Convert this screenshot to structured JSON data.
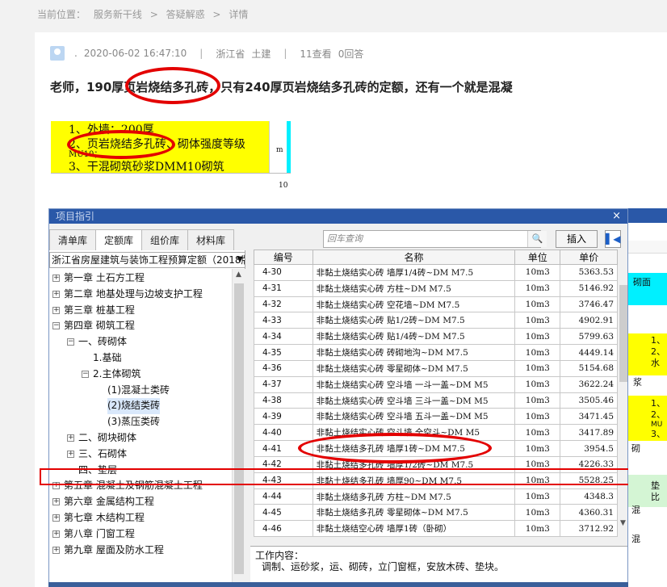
{
  "breadcrumb": [
    "当前位置：",
    "服务新干线",
    ">",
    "答疑解惑",
    ">",
    "详情"
  ],
  "meta": {
    "user": ".",
    "datetime": "2020-06-02 16:47:10",
    "region": "浙江省",
    "category": "土建",
    "views": "11查看",
    "answers": "0回答"
  },
  "question": "老师，190厚页岩烧结多孔砖，只有240厚页岩烧结多孔砖的定额，还有一个就是混凝",
  "excel": {
    "line1": "1、外墙：200厚",
    "line2": "2、页岩烧结多孔砖、砌体强度等级",
    "line2b": "MU10；",
    "line3": "3、干混砌筑砂浆DMM10砌筑",
    "unit_partial": "m",
    "below": "10"
  },
  "dialog": {
    "title": "项目指引",
    "close": "×",
    "tabs": [
      "清单库",
      "定额库",
      "组价库",
      "材料库"
    ],
    "active_tab": 1,
    "library": "浙江省房屋建筑与装饰工程预算定额（2018版）",
    "search_placeholder": "回车查询",
    "insert_label": "插入",
    "tree": [
      {
        "label": "第一章 土石方工程",
        "indent": 0,
        "box": "+"
      },
      {
        "label": "第二章 地基处理与边坡支护工程",
        "indent": 0,
        "box": "+"
      },
      {
        "label": "第三章 桩基工程",
        "indent": 0,
        "box": "+"
      },
      {
        "label": "第四章 砌筑工程",
        "indent": 0,
        "box": "-"
      },
      {
        "label": "一、砖砌体",
        "indent": 1,
        "box": "-"
      },
      {
        "label": "1.基础",
        "indent": 2,
        "box": ""
      },
      {
        "label": "2.主体砌筑",
        "indent": 2,
        "box": "-"
      },
      {
        "label": "(1)混凝土类砖",
        "indent": 3,
        "box": ""
      },
      {
        "label": "(2)烧结类砖",
        "indent": 3,
        "box": "",
        "selected": true
      },
      {
        "label": "(3)蒸压类砖",
        "indent": 3,
        "box": ""
      },
      {
        "label": "二、砌块砌体",
        "indent": 1,
        "box": "+"
      },
      {
        "label": "三、石砌体",
        "indent": 1,
        "box": "+"
      },
      {
        "label": "四、垫层",
        "indent": 1,
        "box": ""
      },
      {
        "label": "第五章 混凝土及钢筋混凝土工程",
        "indent": 0,
        "box": "+"
      },
      {
        "label": "第六章 金属结构工程",
        "indent": 0,
        "box": "+"
      },
      {
        "label": "第七章 木结构工程",
        "indent": 0,
        "box": "+"
      },
      {
        "label": "第八章 门窗工程",
        "indent": 0,
        "box": "+"
      },
      {
        "label": "第九章 屋面及防水工程",
        "indent": 0,
        "box": "+"
      }
    ],
    "columns": [
      "编号",
      "名称",
      "单位",
      "单价"
    ],
    "rows": [
      [
        "4-30",
        "非黏土烧结实心砖 墙厚1/4砖~DM M7.5",
        "10m3",
        "5363.53"
      ],
      [
        "4-31",
        "非黏土烧结实心砖 方柱~DM M7.5",
        "10m3",
        "5146.92"
      ],
      [
        "4-32",
        "非黏土烧结实心砖 空花墙~DM M7.5",
        "10m3",
        "3746.47"
      ],
      [
        "4-33",
        "非黏土烧结实心砖 贴1/2砖~DM M7.5",
        "10m3",
        "4902.91"
      ],
      [
        "4-34",
        "非黏土烧结实心砖 贴1/4砖~DM M7.5",
        "10m3",
        "5799.63"
      ],
      [
        "4-35",
        "非黏土烧结实心砖 砖砌地沟~DM M7.5",
        "10m3",
        "4449.14"
      ],
      [
        "4-36",
        "非黏土烧结实心砖 零星砌体~DM M7.5",
        "10m3",
        "5154.68"
      ],
      [
        "4-37",
        "非黏土烧结实心砖 空斗墙 一斗一盖~DM M5",
        "10m3",
        "3622.24"
      ],
      [
        "4-38",
        "非黏土烧结实心砖 空斗墙 三斗一盖~DM M5",
        "10m3",
        "3505.46"
      ],
      [
        "4-39",
        "非黏土烧结实心砖 空斗墙 五斗一盖~DM M5",
        "10m3",
        "3471.45"
      ],
      [
        "4-40",
        "非黏土烧结实心砖 空斗墙 全空斗~DM M5",
        "10m3",
        "3417.89"
      ],
      [
        "4-41",
        "非黏土烧结多孔砖 墙厚1砖~DM M7.5",
        "10m3",
        "3954.5"
      ],
      [
        "4-42",
        "非黏土烧结多孔砖 墙厚1/2砖~DM M7.5",
        "10m3",
        "4226.33"
      ],
      [
        "4-43",
        "非黏土烧结多孔砖 墙厚90~DM M7.5",
        "10m3",
        "5528.25"
      ],
      [
        "4-44",
        "非黏土烧结多孔砖 方柱~DM M7.5",
        "10m3",
        "4348.3"
      ],
      [
        "4-45",
        "非黏土烧结多孔砖 零星砌体~DM M7.5",
        "10m3",
        "4360.31"
      ],
      [
        "4-46",
        "非黏土烧结空心砖 墙厚1砖（卧砌）",
        "10m3",
        "3712.92"
      ]
    ],
    "work_title": "工作内容：",
    "work_text": "调制、运砂浆，运、砌砖，立门窗框，安放木砖、垫块。"
  },
  "bg_right": {
    "t1": "砌面",
    "t2": "1、",
    "t3": "2、",
    "t4": "水",
    "t5": "浆",
    "t6": "1、",
    "t7": "2、",
    "t8": "MU",
    "t9": "3、",
    "t10": "砌",
    "t11": "垫",
    "t12": "混",
    "t13": "比",
    "t14": "混"
  },
  "colors": {
    "highlight": "#e30000",
    "title_bar": "#2a58a8",
    "excel_yellow": "#ffff00",
    "excel_cyan": "#00f0ff"
  }
}
